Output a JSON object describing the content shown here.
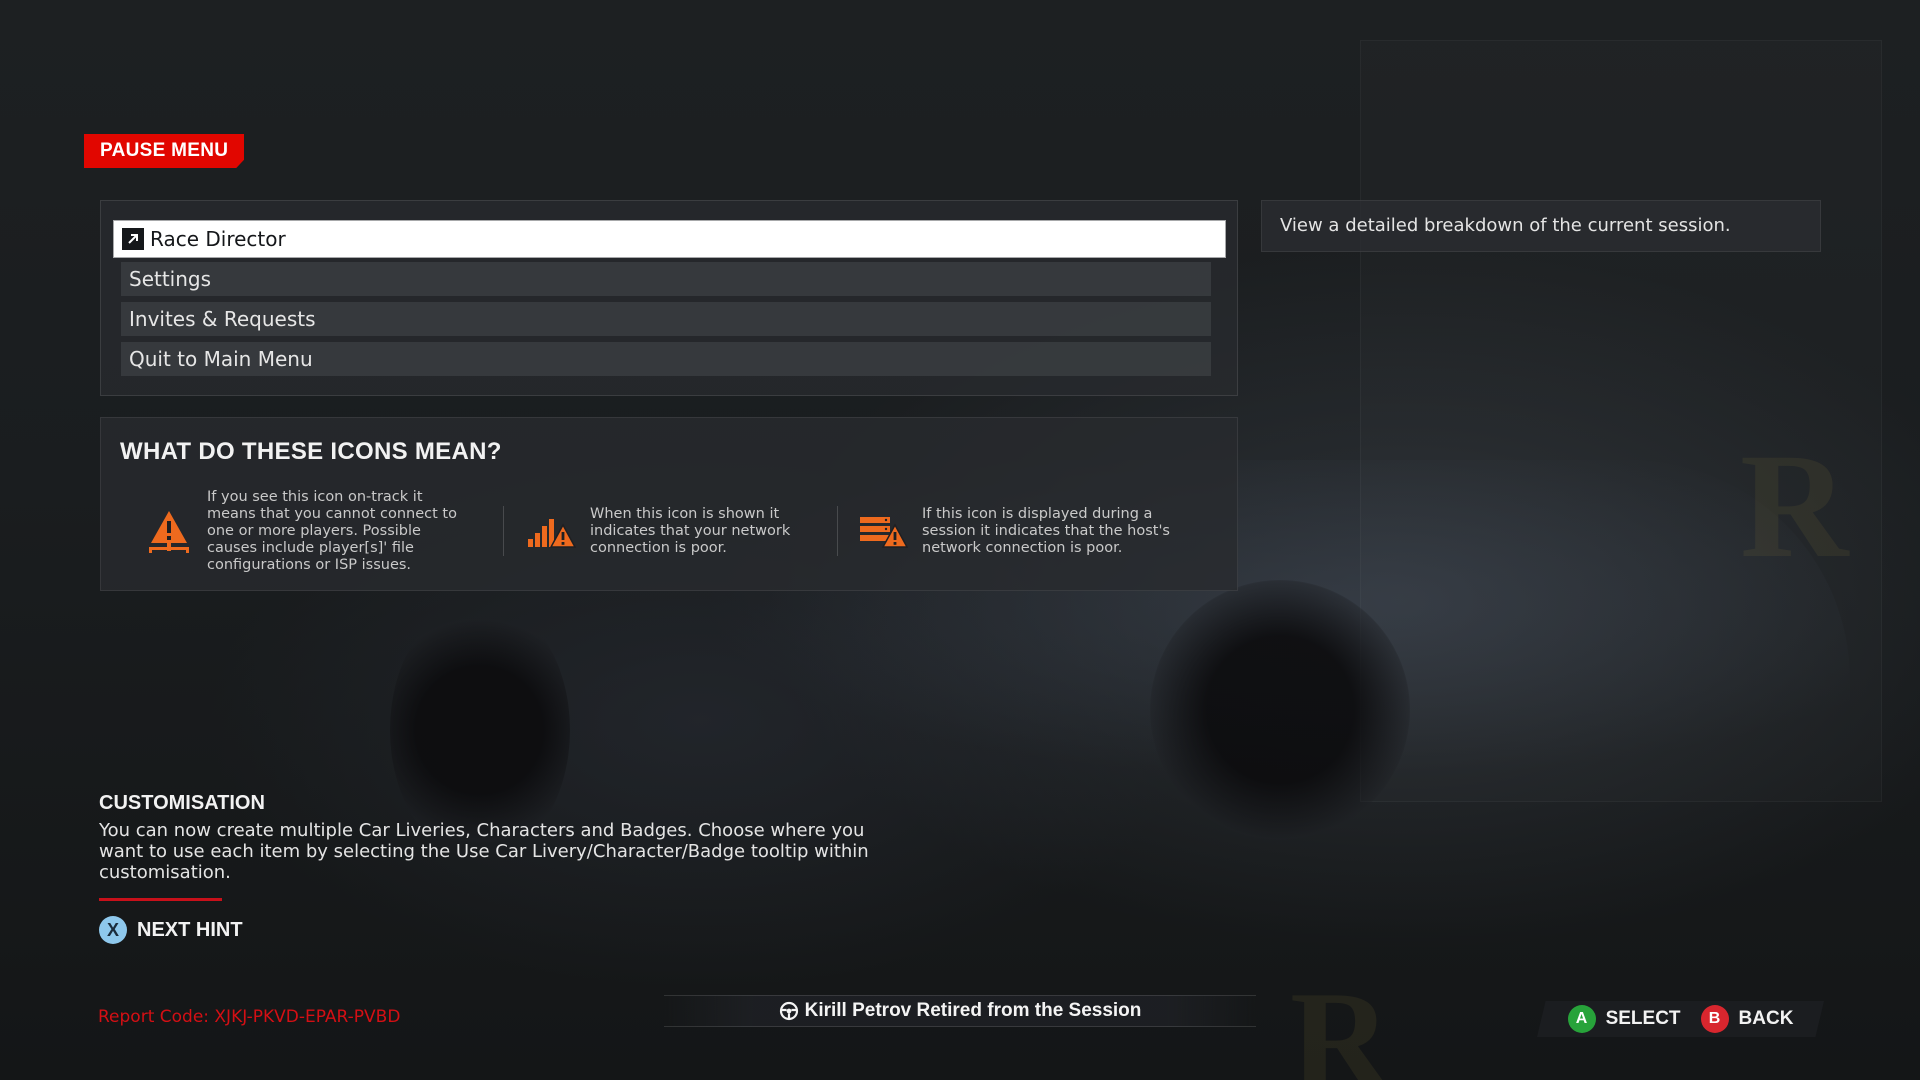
{
  "header": {
    "title": "PAUSE MENU"
  },
  "menu": {
    "items": [
      {
        "label": "Race Director",
        "selected": true,
        "icon": "external-link-icon"
      },
      {
        "label": "Settings",
        "selected": false
      },
      {
        "label": "Invites & Requests",
        "selected": false
      },
      {
        "label": "Quit to Main Menu",
        "selected": false
      }
    ],
    "description": "View a detailed breakdown of the current session."
  },
  "icons_panel": {
    "title": "WHAT DO THESE ICONS MEAN?",
    "entries": [
      {
        "icon": "connection-warning-icon",
        "lines": [
          "If you see this icon on-track it",
          "means that you cannot connect to",
          "one or more players. Possible",
          "causes include player[s]' file",
          "configurations or ISP issues."
        ]
      },
      {
        "icon": "poor-network-icon",
        "lines": [
          "When this icon is shown it",
          "indicates that your network",
          "connection is poor."
        ]
      },
      {
        "icon": "host-network-icon",
        "lines": [
          "If this icon is displayed during a",
          "session it indicates that the host's",
          "network connection is poor."
        ]
      }
    ]
  },
  "hint": {
    "title": "CUSTOMISATION",
    "lines": [
      "You can now create multiple Car Liveries, Characters and Badges. Choose where you",
      "want to use each item by selecting the Use Car Livery/Character/Badge tooltip within",
      "customisation."
    ],
    "next_button_glyph": "X",
    "next_label": "NEXT HINT"
  },
  "report_code": "Report Code: XJKJ-PKVD-EPAR-PVBD",
  "notification": {
    "icon": "steering-wheel-icon",
    "text": "Kirill Petrov Retired from the Session"
  },
  "prompts": {
    "select": {
      "glyph": "A",
      "label": "SELECT"
    },
    "back": {
      "glyph": "B",
      "label": "BACK"
    }
  },
  "colors": {
    "accent_red": "#e10600",
    "report_red": "#d40f14",
    "warning_orange": "#ee6a1e",
    "button_a_green": "#27a33a",
    "button_b_red": "#d8262e",
    "button_x_blue": "#8ec8ec"
  }
}
